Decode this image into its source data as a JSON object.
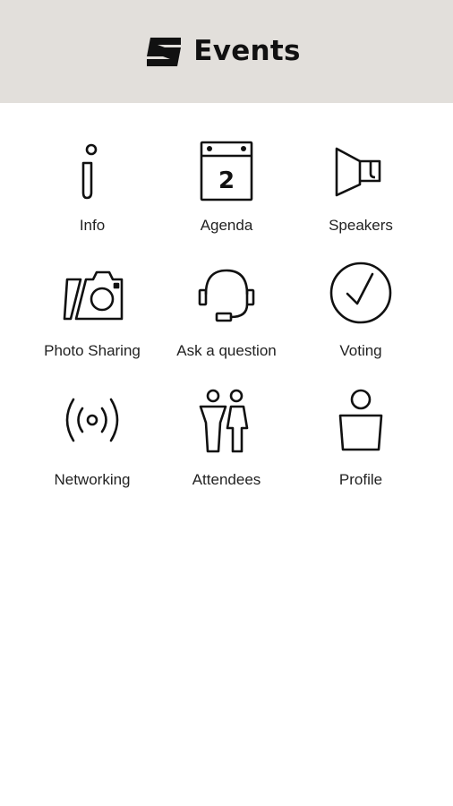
{
  "header": {
    "title": "Events",
    "logo_icon": "seat-logo-icon",
    "background": "#e2dfdb"
  },
  "menu": {
    "items": [
      {
        "label": "Info",
        "icon": "info-icon"
      },
      {
        "label": "Agenda",
        "icon": "calendar-icon",
        "calendar_day": "2"
      },
      {
        "label": "Speakers",
        "icon": "megaphone-icon"
      },
      {
        "label": "Photo Sharing",
        "icon": "camera-icon"
      },
      {
        "label": "Ask a question",
        "icon": "headset-icon"
      },
      {
        "label": "Voting",
        "icon": "checkmark-circle-icon"
      },
      {
        "label": "Networking",
        "icon": "broadcast-icon"
      },
      {
        "label": "Attendees",
        "icon": "attendees-icon"
      },
      {
        "label": "Profile",
        "icon": "profile-icon"
      }
    ]
  }
}
